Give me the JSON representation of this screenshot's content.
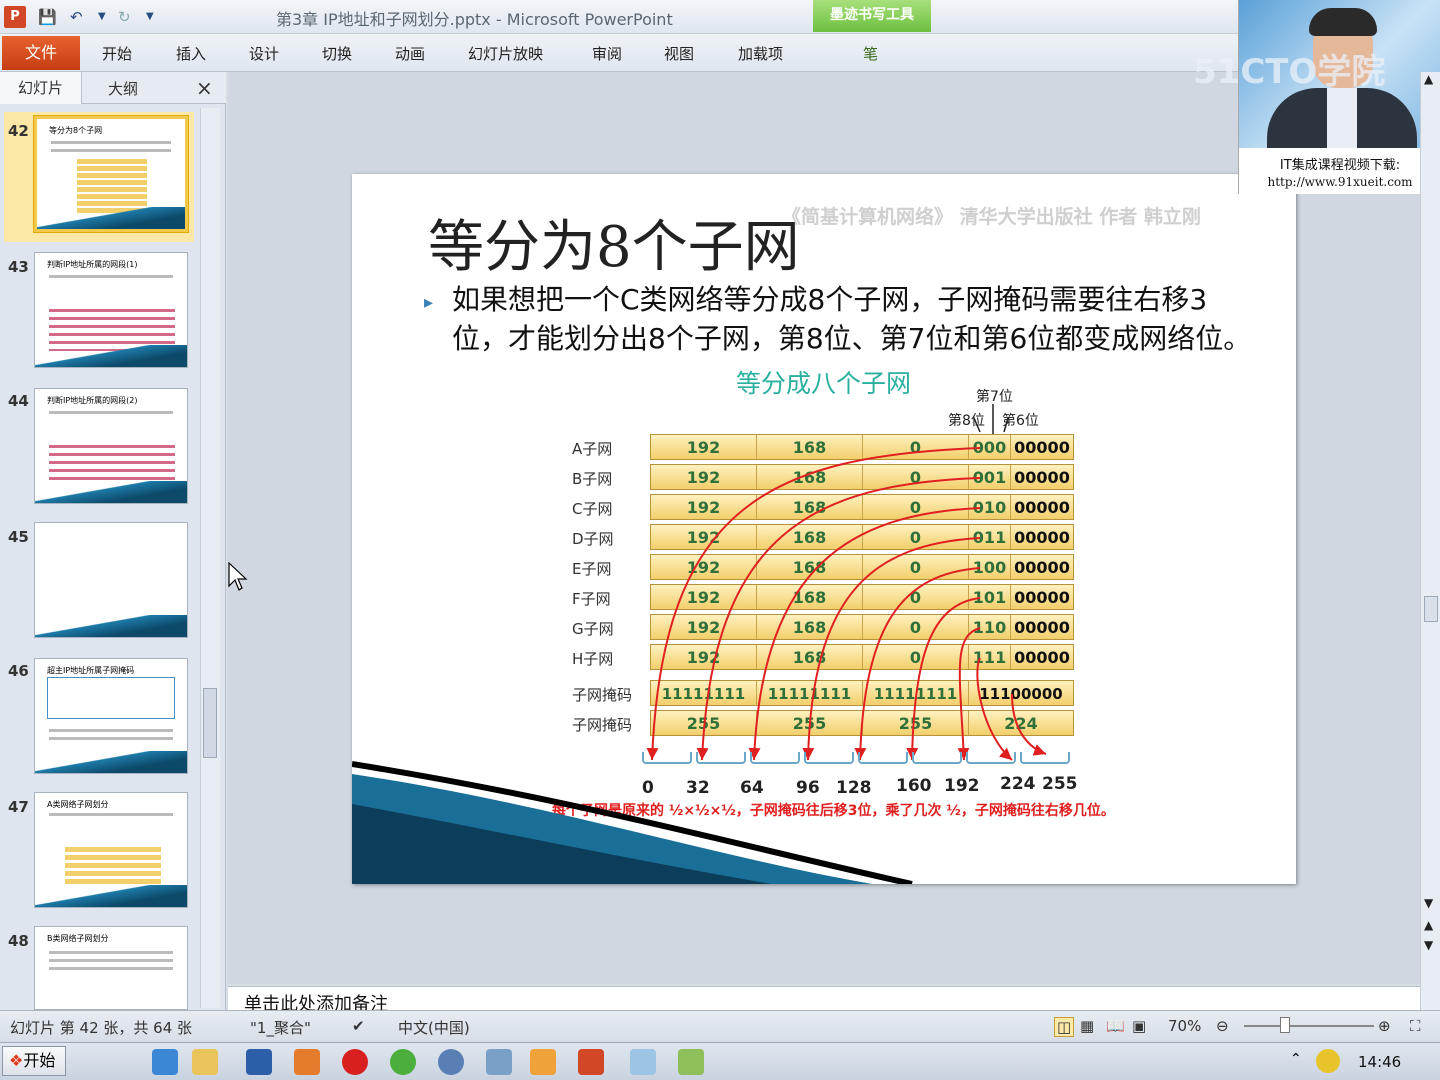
{
  "titlebar": {
    "window_title": "第3章 IP地址和子网划分.pptx - Microsoft PowerPoint",
    "context_tool": "墨迹书写工具",
    "app_icon": "P"
  },
  "ribbon": {
    "file": "文件",
    "tabs": [
      "开始",
      "插入",
      "设计",
      "切换",
      "动画",
      "幻灯片放映",
      "审阅",
      "视图",
      "加载项",
      "笔"
    ]
  },
  "video": {
    "watermark": "51CTO学院",
    "caption1": "IT集成课程视频下载:",
    "caption2": "http://www.91xueit.com"
  },
  "left_pane": {
    "tab_slides": "幻灯片",
    "tab_outline": "大纲",
    "close": "×",
    "slides": [
      {
        "num": "42",
        "title": "等分为8个子网"
      },
      {
        "num": "43",
        "title": "判断IP地址所属的网段(1)"
      },
      {
        "num": "44",
        "title": "判断IP地址所属的网段(2)"
      },
      {
        "num": "45",
        "title": ""
      },
      {
        "num": "46",
        "title": "超主IP地址所属子网掩码"
      },
      {
        "num": "47",
        "title": "A类网络子网划分"
      },
      {
        "num": "48",
        "title": "B类网络子网划分"
      }
    ]
  },
  "slide": {
    "title": "等分为8个子网",
    "credit": "《简基计算机网络》 清华大学出版社 作者 韩立刚",
    "bullet": "如果想把一个C类网络等分成8个子网，子网掩码需要往右移3位，才能划分出8个子网，第8位、第7位和第6位都变成网络位。",
    "subtitle": "等分成八个子网",
    "bit7": "第7位",
    "bit8": "第8位",
    "bit6": "第6位",
    "rows": [
      {
        "label": "A子网",
        "o1": "192",
        "o2": "168",
        "o3": "0",
        "net": "000",
        "host": "00000"
      },
      {
        "label": "B子网",
        "o1": "192",
        "o2": "168",
        "o3": "0",
        "net": "001",
        "host": "00000"
      },
      {
        "label": "C子网",
        "o1": "192",
        "o2": "168",
        "o3": "0",
        "net": "010",
        "host": "00000"
      },
      {
        "label": "D子网",
        "o1": "192",
        "o2": "168",
        "o3": "0",
        "net": "011",
        "host": "00000"
      },
      {
        "label": "E子网",
        "o1": "192",
        "o2": "168",
        "o3": "0",
        "net": "100",
        "host": "00000"
      },
      {
        "label": "F子网",
        "o1": "192",
        "o2": "168",
        "o3": "0",
        "net": "101",
        "host": "00000"
      },
      {
        "label": "G子网",
        "o1": "192",
        "o2": "168",
        "o3": "0",
        "net": "110",
        "host": "00000"
      },
      {
        "label": "H子网",
        "o1": "192",
        "o2": "168",
        "o3": "0",
        "net": "111",
        "host": "00000"
      }
    ],
    "mask_bin": {
      "label": "子网掩码",
      "o1": "11111111",
      "o2": "11111111",
      "o3": "11111111",
      "o4": "11100000"
    },
    "mask_dec": {
      "label": "子网掩码",
      "o1": "255",
      "o2": "255",
      "o3": "255",
      "o4": "224"
    },
    "axis": [
      "0",
      "32",
      "64",
      "96",
      "128",
      "160",
      "192",
      "224",
      "255"
    ],
    "note": "每个子网是原来的 ½×½×½，子网掩码往后移3位，乘了几次 ½，子网掩码往右移几位。"
  },
  "notes_placeholder": "单击此处添加备注",
  "status": {
    "slide_info": "幻灯片 第 42 张，共 64 张",
    "theme": "\"1_聚合\"",
    "language": "中文(中国)",
    "zoom": "70%"
  },
  "taskbar": {
    "start": "开始",
    "clock": "14:46"
  }
}
